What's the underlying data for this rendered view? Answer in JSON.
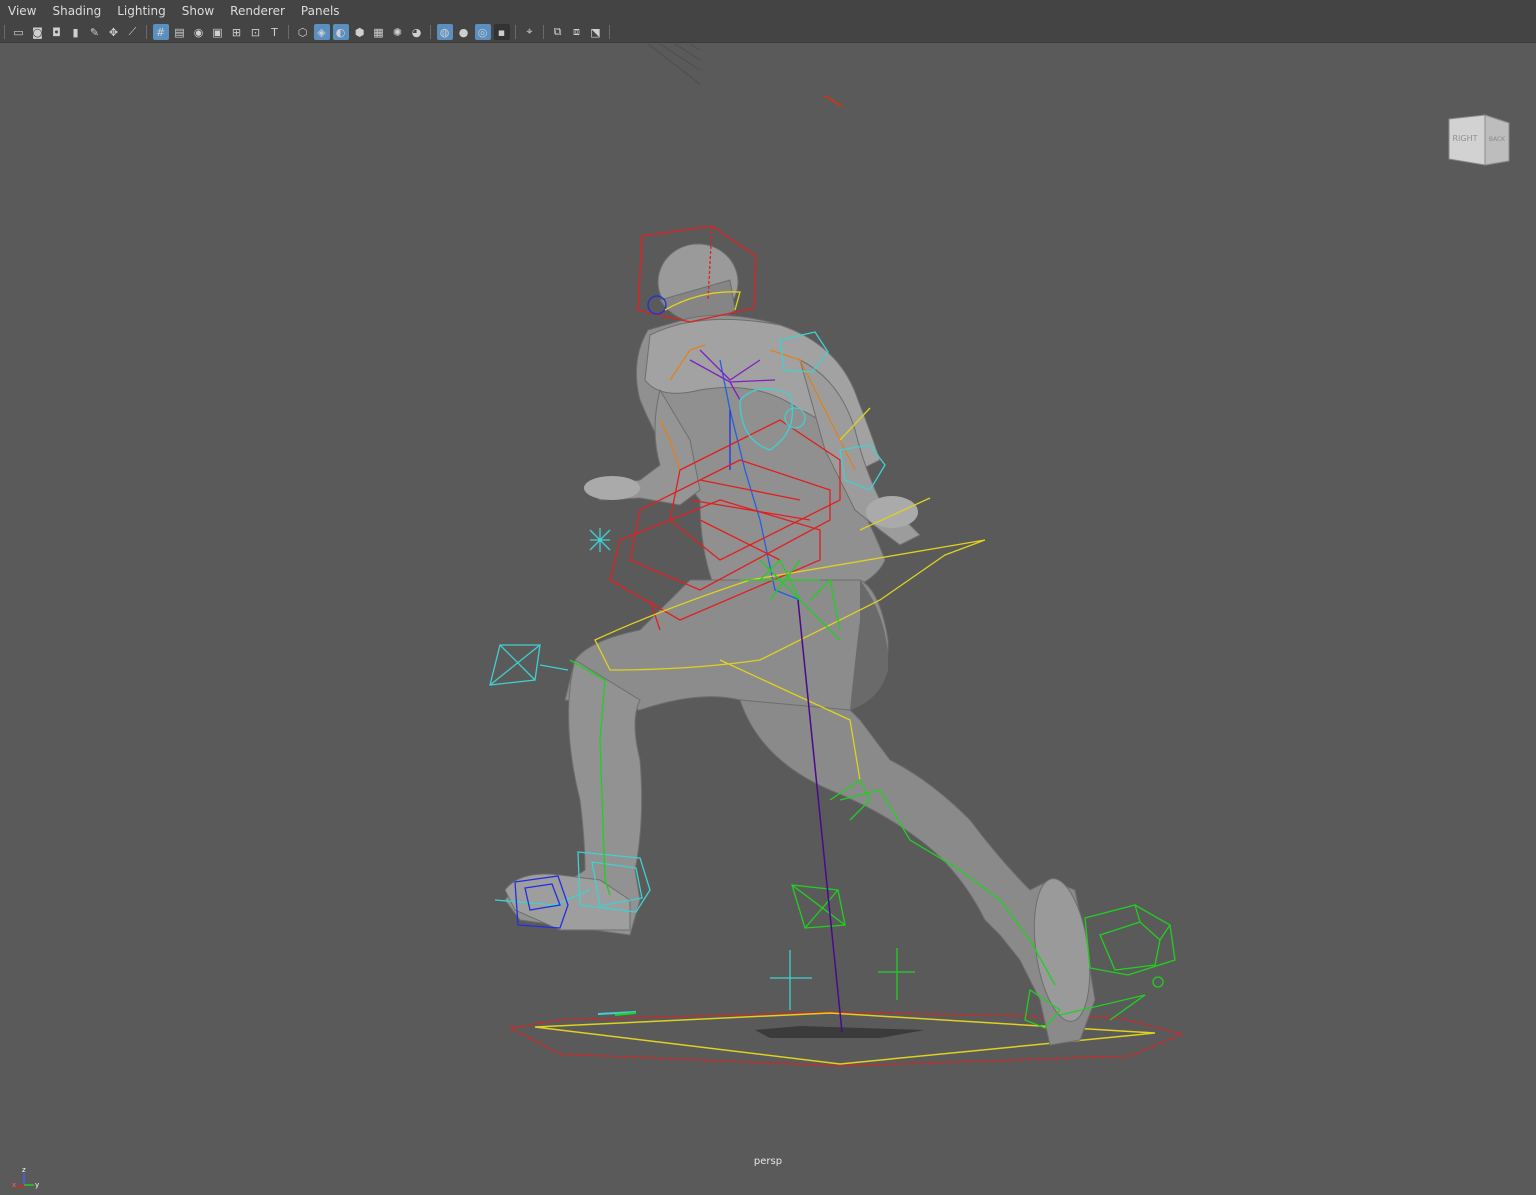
{
  "menubar": {
    "items": [
      "View",
      "Shading",
      "Lighting",
      "Show",
      "Renderer",
      "Panels"
    ]
  },
  "toolbar": {
    "groups": [
      [
        "select-camera-icon",
        "camera-attributes-icon",
        "bookmarks-icon",
        "image-plane-icon",
        "grid-toggle-icon",
        "move-camera-icon",
        "pan-zoom-icon"
      ],
      [
        "grid-icon",
        "film-gate-icon",
        "resolution-gate-icon",
        "gate-mask-icon",
        "field-chart-icon",
        "safe-action-icon",
        "safe-title-icon"
      ],
      [
        "wireframe-icon",
        "smooth-shade-icon",
        "wireframe-on-shaded-icon",
        "default-material-icon",
        "textured-icon",
        "use-all-lights-icon",
        "shadows-icon"
      ],
      [
        "screen-space-ao-icon",
        "motion-blur-icon",
        "anti-aliasing-icon",
        "depth-of-field-icon"
      ],
      [
        "isolate-select-icon"
      ],
      [
        "xray-icon",
        "xray-joints-icon",
        "xray-active-components-icon"
      ]
    ],
    "active": [
      "grid-icon",
      "smooth-shade-icon",
      "wireframe-on-shaded-icon",
      "screen-space-ao-icon",
      "anti-aliasing-icon"
    ]
  },
  "viewport": {
    "camera_name": "persp",
    "background_color": "#5a5a5a",
    "viewcube": {
      "front_label": "RIGHT",
      "side_label": "BACK"
    },
    "axis_labels": {
      "x": "x",
      "y": "y",
      "z": "z"
    }
  },
  "colors": {
    "menubar_bg": "#444444",
    "viewport_bg": "#5a5a5a",
    "control_red": "#e02020",
    "control_yellow": "#e0d020",
    "control_cyan": "#40d0d0",
    "control_green": "#20d020",
    "control_blue": "#2030e0",
    "joint_purple": "#8020c0"
  }
}
